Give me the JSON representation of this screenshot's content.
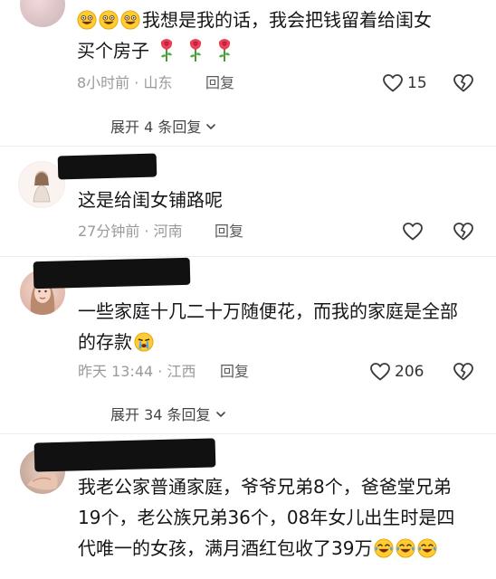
{
  "comments": [
    {
      "line1": "我想是我的话，我会把钱留着给闺女",
      "line2": "买个房子",
      "time": "8小时前",
      "sep": " · ",
      "location": "山东",
      "reply": "回复",
      "likes": "15",
      "expand": "展开 4 条回复"
    },
    {
      "line1": "这是给闺女铺路呢",
      "time": "27分钟前",
      "sep": " · ",
      "location": "河南",
      "reply": "回复"
    },
    {
      "line1": "一些家庭十几二十万随便花，而我的家庭是全部",
      "line2": "的存款",
      "time": "昨天 13:44",
      "sep": " · ",
      "location": "江西",
      "reply": "回复",
      "likes": "206",
      "expand": "展开 34 条回复"
    },
    {
      "line1": "我老公家普通家庭，爷爷兄弟8个，爸爸堂兄弟",
      "line2": "19个，老公族兄弟36个，08年女儿出生时是四",
      "line3": "代唯一的女孩，满月酒红包收了39万"
    }
  ],
  "icons": {
    "like": "heart-outline-icon",
    "dislike": "broken-heart-icon",
    "expand": "chevron-down-icon",
    "emoji_smile": "grinning-emoji",
    "emoji_cry": "crying-emoji",
    "emoji_laugh": "tears-of-joy-emoji",
    "rose": "rose-emoji"
  },
  "colors": {
    "text": "#161616",
    "meta": "#9a9a9a",
    "redaction": "#111111"
  }
}
